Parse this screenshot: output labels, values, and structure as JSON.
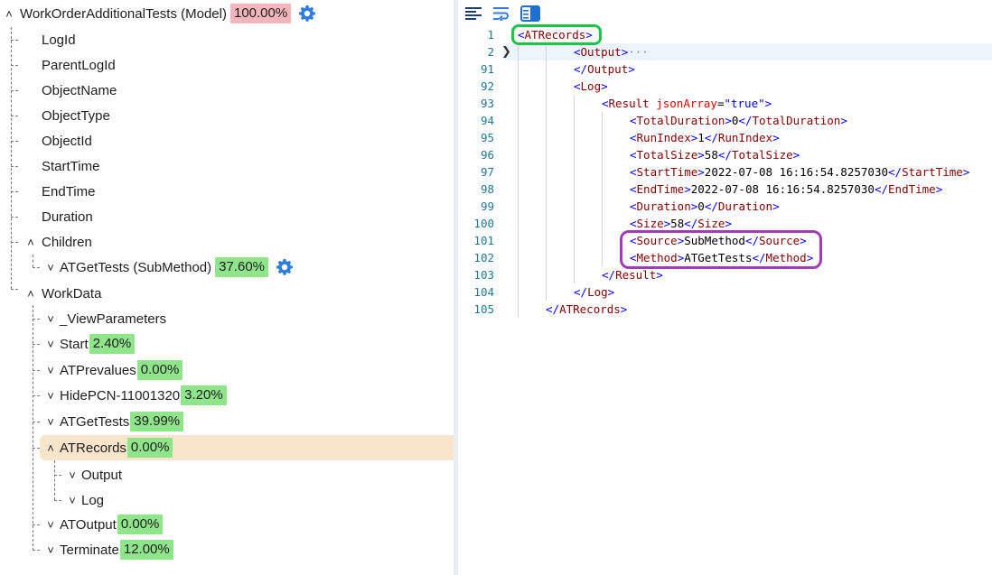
{
  "tree": {
    "root": {
      "label": "WorkOrderAdditionalTests (Model)",
      "percent": "100.00%"
    },
    "fields": [
      "LogId",
      "ParentLogId",
      "ObjectName",
      "ObjectType",
      "ObjectId",
      "StartTime",
      "EndTime",
      "Duration"
    ],
    "children_label": "Children",
    "child_item": {
      "label": "ATGetTests (SubMethod)",
      "percent": "37.60%"
    },
    "workdata_label": "WorkData",
    "workdata_items": [
      {
        "label": "_ViewParameters",
        "percent": ""
      },
      {
        "label": "Start",
        "percent": "2.40%"
      },
      {
        "label": "ATPrevalues",
        "percent": "0.00%"
      },
      {
        "label": "HidePCN-11001320",
        "percent": "3.20%"
      },
      {
        "label": "ATGetTests",
        "percent": "39.99%"
      },
      {
        "label": "ATRecords",
        "percent": "0.00%"
      }
    ],
    "atrecords_children": [
      "Output",
      "Log"
    ],
    "workdata_tail": [
      {
        "label": "ATOutput",
        "percent": "0.00%"
      },
      {
        "label": "Terminate",
        "percent": "12.00%"
      }
    ]
  },
  "toolbar": {
    "icons": [
      "format-lines-icon",
      "word-wrap-icon",
      "preview-panel-icon"
    ]
  },
  "code": {
    "line_numbers": [
      "1",
      "2",
      "91",
      "92",
      "93",
      "94",
      "95",
      "96",
      "97",
      "98",
      "99",
      "100",
      "101",
      "102",
      "103",
      "104",
      "105"
    ],
    "folded_marker": "···",
    "lines": {
      "l1": "ATRecords",
      "l2": "Output",
      "l91": "Output",
      "l92": "Log",
      "l93_tag": "Result",
      "l93_attr": "jsonArray",
      "l93_val": "\"true\"",
      "l94": {
        "tag": "TotalDuration",
        "value": "0"
      },
      "l95": {
        "tag": "RunIndex",
        "value": "1"
      },
      "l96": {
        "tag": "TotalSize",
        "value": "58"
      },
      "l97": {
        "tag": "StartTime",
        "value": "2022-07-08 16:16:54.8257030"
      },
      "l98": {
        "tag": "EndTime",
        "value": "2022-07-08 16:16:54.8257030"
      },
      "l99": {
        "tag": "Duration",
        "value": "0"
      },
      "l100": {
        "tag": "Size",
        "value": "58"
      },
      "l101": {
        "tag": "Source",
        "value": "SubMethod"
      },
      "l102": {
        "tag": "Method",
        "value": "ATGetTests"
      },
      "l103": "Result",
      "l104": "Log",
      "l105": "ATRecords"
    }
  },
  "colors": {
    "percent_root": "#f4b6bd",
    "percent_green": "#8fe58a",
    "selected_row": "#f9e4cc",
    "highlight_green": "#1cc44a",
    "highlight_purple": "#a23cb5"
  }
}
